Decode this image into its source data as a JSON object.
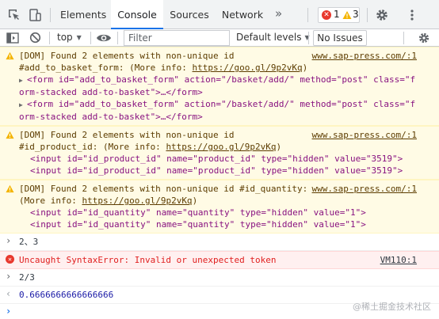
{
  "tabs": {
    "elements": "Elements",
    "console": "Console",
    "sources": "Sources",
    "network": "Network",
    "more": "»"
  },
  "badges": {
    "errors": "1",
    "warnings": "3"
  },
  "toolbar": {
    "context": "top",
    "filter_placeholder": "Filter",
    "levels": "Default levels",
    "issues": "No Issues"
  },
  "messages": {
    "w1": {
      "line1": "[DOM] Found 2 elements with non-unique id",
      "line2_pre": "#add_to_basket_form: (More info: ",
      "link": "https://goo.gl/9p2vKq",
      "line2_post": ")",
      "source": "www.sap-press.com/:1",
      "el1_a": "<form id=\"add_to_basket_form\" action=\"/basket/add/\" method=\"post\" class=\"f",
      "el1_b": "orm-stacked add-to-basket\">…</form>",
      "el2_a": "<form id=\"add_to_basket_form\" action=\"/basket/add/\" method=\"post\" class=\"f",
      "el2_b": "orm-stacked add-to-basket\">…</form>"
    },
    "w2": {
      "line1": "[DOM] Found 2 elements with non-unique id",
      "line2_pre": "#id_product_id: (More info: ",
      "link": "https://goo.gl/9p2vKq",
      "line2_post": ")",
      "source": "www.sap-press.com/:1",
      "el1": "<input id=\"id_product_id\" name=\"product_id\" type=\"hidden\" value=\"3519\">",
      "el2": "<input id=\"id_product_id\" name=\"product_id\" type=\"hidden\" value=\"3519\">"
    },
    "w3": {
      "line1": "[DOM] Found 2 elements with non-unique id #id_quantity:",
      "line2_pre": "(More info: ",
      "link": "https://goo.gl/9p2vKq",
      "line2_post": ")",
      "source": "www.sap-press.com/:1",
      "el1": "<input id=\"id_quantity\" name=\"quantity\" type=\"hidden\" value=\"1\">",
      "el2": "<input id=\"id_quantity\" name=\"quantity\" type=\"hidden\" value=\"1\">"
    },
    "input1": "2、3",
    "error": {
      "text": "Uncaught SyntaxError: Invalid or unexpected token",
      "source": "VM110:1"
    },
    "input2": "2/3",
    "result2": "0.6666666666666666"
  },
  "watermark": "@稀土掘金技术社区",
  "colors": {
    "accent": "#1a73e8",
    "warning_bg": "#fffbe5",
    "error_bg": "#fff0f0",
    "error_text": "#e02020"
  }
}
